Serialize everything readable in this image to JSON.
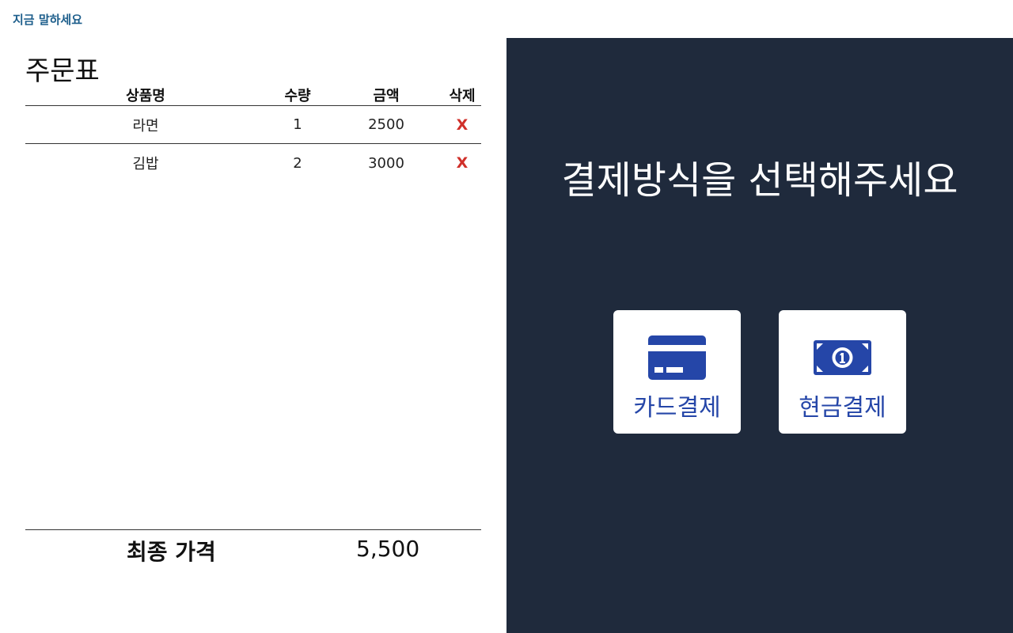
{
  "voice_hint": "지금 말하세요",
  "order": {
    "title": "주문표",
    "headers": {
      "name": "상품명",
      "qty": "수량",
      "price": "금액",
      "delete": "삭제"
    },
    "items": [
      {
        "name": "라면",
        "qty": "1",
        "price": "2500",
        "delete": "X"
      },
      {
        "name": "김밥",
        "qty": "2",
        "price": "3000",
        "delete": "X"
      }
    ],
    "total_label": "최종 가격",
    "total_value": "5,500"
  },
  "payment": {
    "prompt": "결제방식을 선택해주세요",
    "card": {
      "label": "카드결제",
      "icon": "credit-card-icon"
    },
    "cash": {
      "label": "현금결제",
      "icon": "banknote-icon"
    }
  },
  "colors": {
    "panel_bg": "#1f2a3c",
    "accent": "#2546a8",
    "delete": "#d0302a",
    "hint": "#1e5f8c"
  }
}
